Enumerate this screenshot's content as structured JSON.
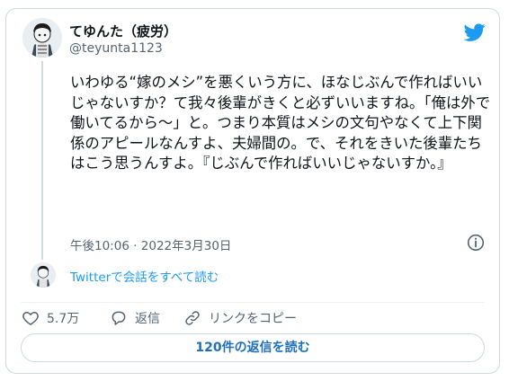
{
  "author": {
    "display_name": "てゆんた（疲労）",
    "handle": "@teyunta1123"
  },
  "tweet": {
    "text": "いわゆる“嫁のメシ”を悪くいう方に、ほなじぶんで作ればいいじゃないすか？て我々後輩がきくと必ずいいますね。「俺は外で働いてるから〜」と。つまり本質はメシの文句やなくて上下関係のアピールなんすよ、夫婦間の。で、それをきいた後輩たちはこう思うんすよ。『じぶんで作ればいいじゃないすか。』",
    "timestamp": "午後10:06 · 2022年3月30日"
  },
  "thread_link": "Twitterで会話をすべて読む",
  "actions": {
    "likes_count": "5.7万",
    "reply_label": "返信",
    "copy_link_label": "リンクをコピー"
  },
  "replies_button": "120件の返信を読む",
  "icons": [
    "twitter-bird-icon",
    "info-icon",
    "heart-icon",
    "reply-icon",
    "link-icon"
  ],
  "colors": {
    "accent": "#1d9bf0",
    "text": "#0f1419",
    "secondary_text": "#536471",
    "border": "#cfd9de"
  }
}
